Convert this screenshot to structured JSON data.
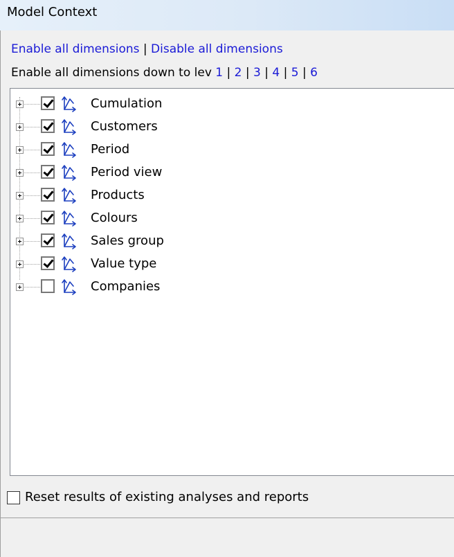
{
  "window": {
    "title": "Model Context"
  },
  "links": {
    "enable_all": "Enable all dimensions",
    "separator": " | ",
    "disable_all": "Disable all dimensions"
  },
  "levels": {
    "prefix": "Enable all dimensions down to lev",
    "items": [
      "1",
      "2",
      "3",
      "4",
      "5",
      "6"
    ],
    "separator": " | "
  },
  "tree": {
    "items": [
      {
        "label": "Cumulation",
        "checked": true
      },
      {
        "label": "Customers",
        "checked": true
      },
      {
        "label": "Period",
        "checked": true
      },
      {
        "label": "Period view",
        "checked": true
      },
      {
        "label": "Products",
        "checked": true
      },
      {
        "label": "Colours",
        "checked": true
      },
      {
        "label": "Sales group",
        "checked": true
      },
      {
        "label": "Value type",
        "checked": true
      },
      {
        "label": "Companies",
        "checked": false
      }
    ]
  },
  "reset": {
    "label": "Reset results of existing analyses and reports",
    "checked": false
  },
  "colors": {
    "link": "#1a1ad6",
    "icon": "#1c3fbf"
  }
}
